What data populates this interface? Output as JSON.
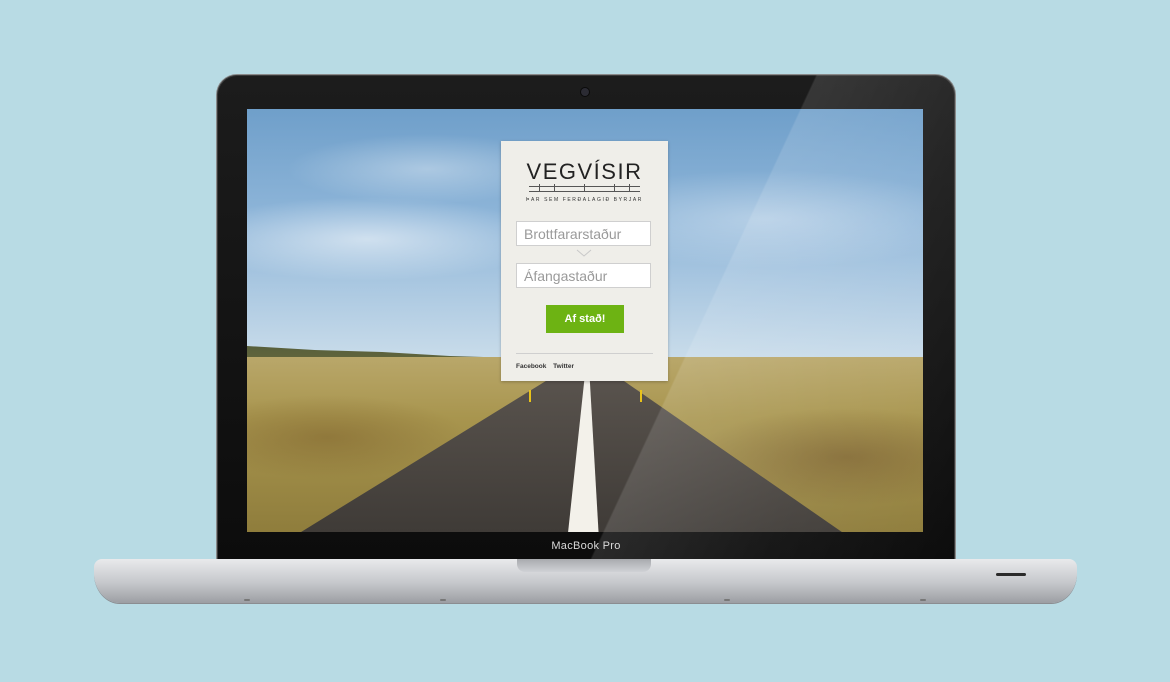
{
  "laptop": {
    "brand_label": "MacBook Pro"
  },
  "app": {
    "logo_text": "VEGVÍSIR",
    "tagline": "ÞAR SEM FERÐALAGIÐ BYRJAR",
    "from_placeholder": "Brottfararstaður",
    "to_placeholder": "Áfangastaður",
    "submit_label": "Af stað!",
    "social_links": [
      "Facebook",
      "Twitter"
    ],
    "accent_color": "#6db313"
  },
  "icons": {
    "swap": "chevron-down-icon",
    "camera": "camera-icon"
  }
}
